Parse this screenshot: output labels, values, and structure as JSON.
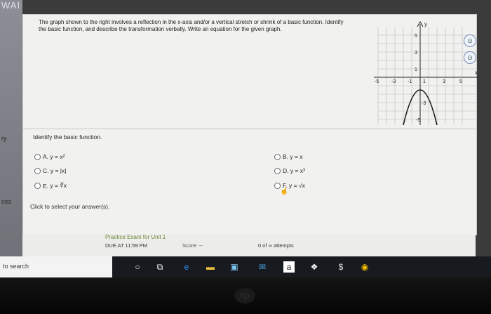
{
  "app": {
    "logo": "WAI"
  },
  "side": {
    "label1": "ry",
    "label2": "ces"
  },
  "question": {
    "text": "The graph shown to the right involves a reflection in the x-axis and/or a vertical stretch or shrink of a basic function. Identify the basic function, and describe the transformation verbally. Write an equation for the given graph."
  },
  "graph": {
    "ylabel": "y",
    "xlabel": "x",
    "yticks": [
      "5",
      "3",
      "1",
      "-3",
      "-5"
    ],
    "xticks": [
      "-5",
      "-3",
      "-1",
      "1",
      "3",
      "5"
    ]
  },
  "identify": {
    "label": "Identify the basic function."
  },
  "options": {
    "a": {
      "letter": "A.",
      "eq": "y = x²"
    },
    "b": {
      "letter": "B.",
      "eq": "y = x"
    },
    "c": {
      "letter": "C.",
      "eq": "y = |x|"
    },
    "d": {
      "letter": "D.",
      "eq": "y = x³"
    },
    "e": {
      "letter": "E.",
      "eq": "y = ∛x"
    },
    "f": {
      "letter": "F.",
      "eq": "y = √x"
    }
  },
  "click_note": "Click to select your answer(s).",
  "footer": {
    "tab": "Practice Exam for Unit 1",
    "due": "DUE AT 11:59 PM",
    "score": "Score: --",
    "attempts": "0 of ∞ attempts"
  },
  "taskbar": {
    "search": "to search"
  },
  "bezel": {
    "logo": "hp"
  }
}
